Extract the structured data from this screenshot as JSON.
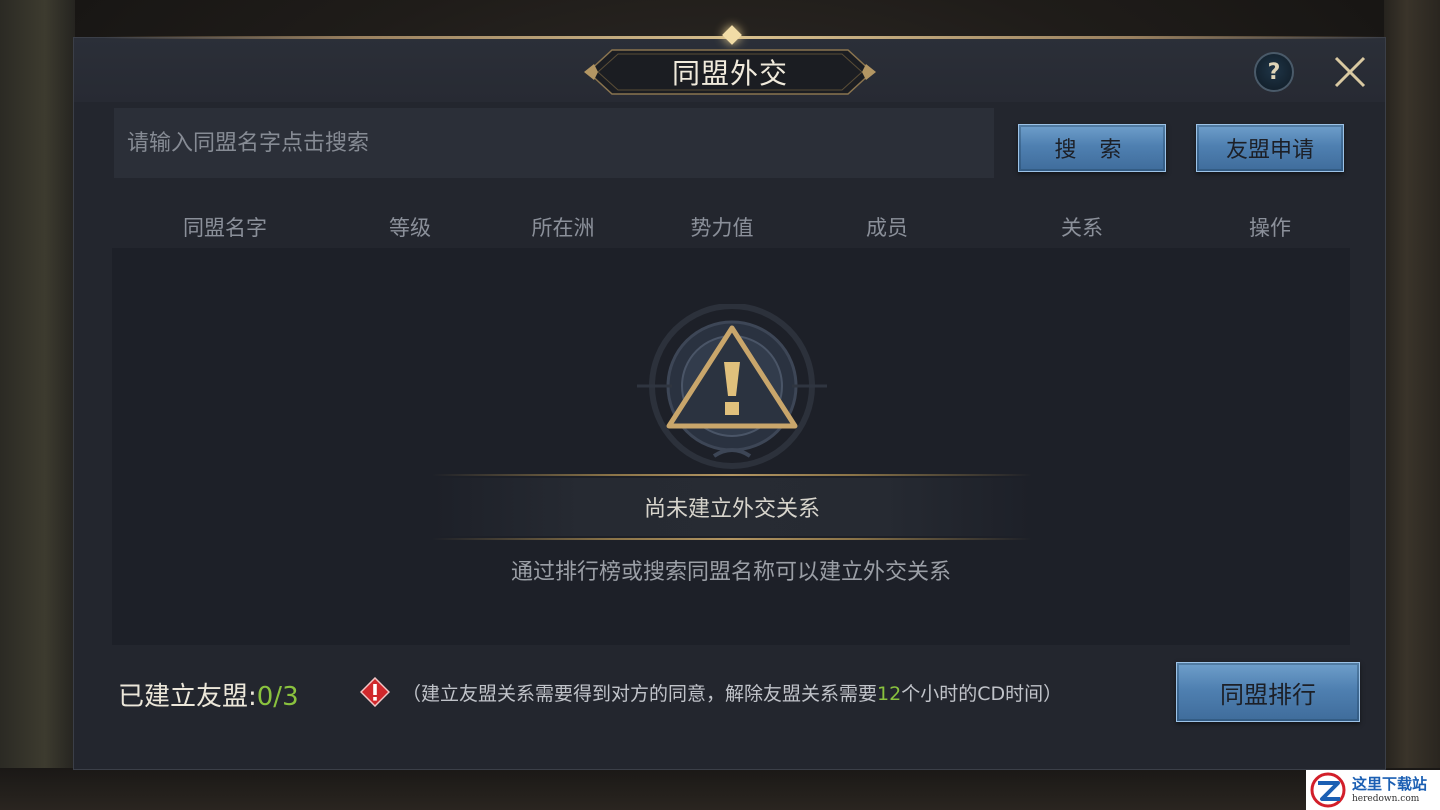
{
  "dialog": {
    "title": "同盟外交"
  },
  "search": {
    "placeholder": "请输入同盟名字点击搜索",
    "search_label": "搜 索",
    "apply_label": "友盟申请"
  },
  "table": {
    "columns": [
      "同盟名字",
      "等级",
      "所在洲",
      "势力值",
      "成员",
      "关系",
      "操作"
    ]
  },
  "empty_state": {
    "title": "尚未建立外交关系",
    "hint": "通过排行榜或搜索同盟名称可以建立外交关系"
  },
  "footer": {
    "established_label": "已建立友盟:",
    "established_count": "0/3",
    "notice_prefix": "（建立友盟关系需要得到对方的同意，解除友盟关系需要",
    "notice_hours": "12",
    "notice_suffix": "个小时的CD时间）",
    "ranking_label": "同盟排行"
  },
  "watermark": {
    "cn": "这里下载站",
    "en": "heredown.com"
  },
  "colors": {
    "accent_green": "#8ac23e",
    "button_blue": "#4f80b1",
    "gold": "#d8c08e"
  }
}
